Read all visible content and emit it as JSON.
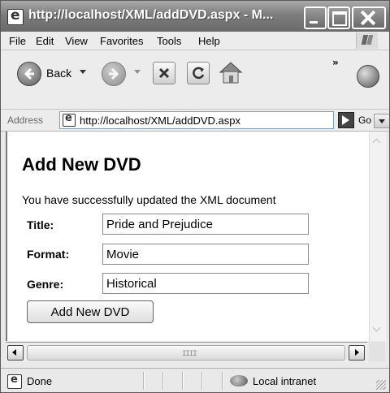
{
  "window": {
    "title": "http://localhost/XML/addDVD.aspx - M..."
  },
  "menu": {
    "items": [
      "File",
      "Edit",
      "View",
      "Favorites",
      "Tools",
      "Help"
    ]
  },
  "toolbar": {
    "back_label": "Back",
    "overflow": "»"
  },
  "address": {
    "label": "Address",
    "url": "http://localhost/XML/addDVD.aspx",
    "go_label": "Go"
  },
  "page": {
    "title": "Add New DVD",
    "message": "You have successfully updated the XML document",
    "fields": [
      {
        "label": "Title:",
        "value": "Pride and Prejudice"
      },
      {
        "label": "Format:",
        "value": "Movie"
      },
      {
        "label": "Genre:",
        "value": "Historical"
      }
    ],
    "button": "Add New DVD"
  },
  "scroll": {
    "grip": "IIII"
  },
  "status": {
    "text": "Done",
    "zone": "Local intranet"
  }
}
